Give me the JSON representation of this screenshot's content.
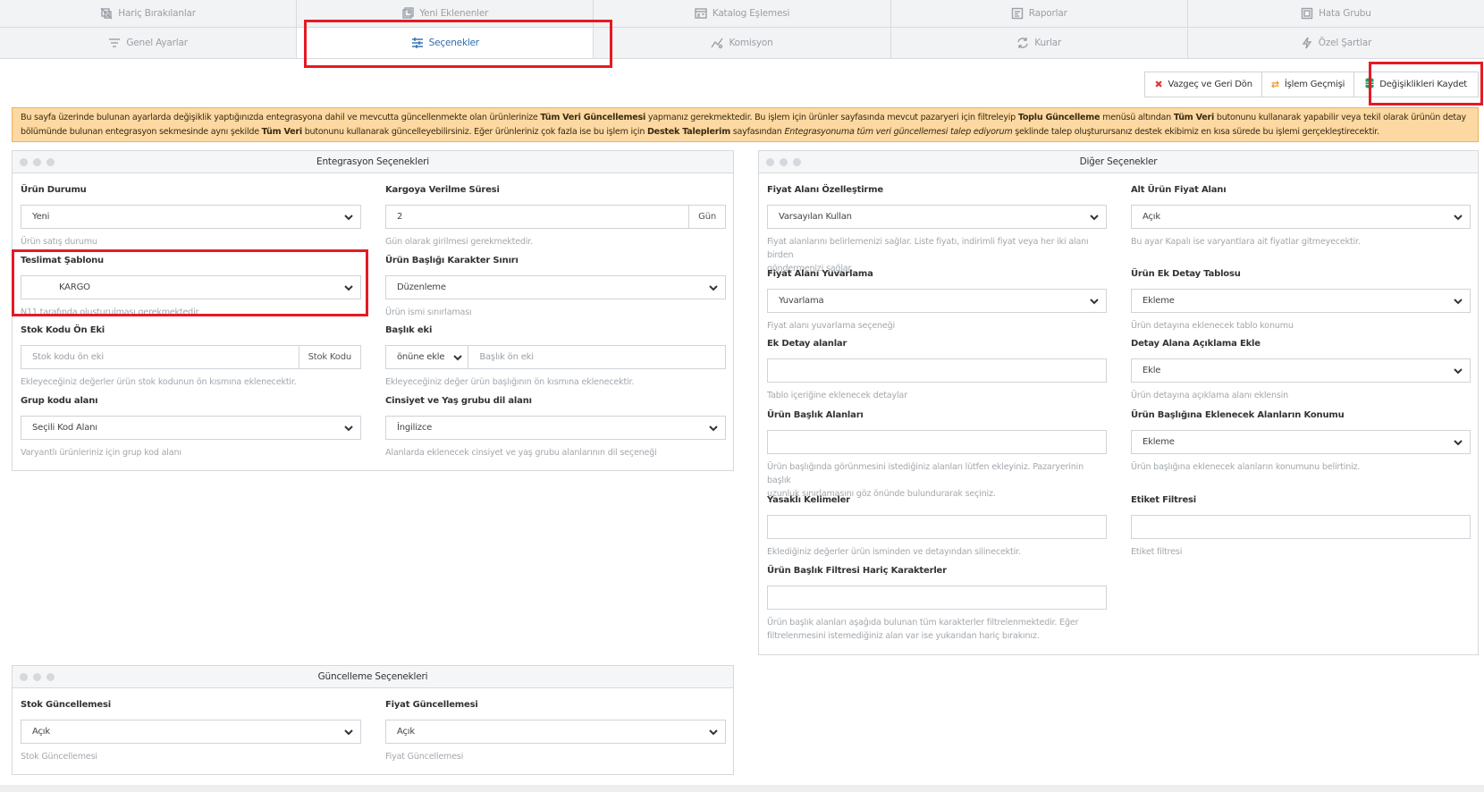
{
  "tabs_row1": [
    {
      "label": "Hariç Bırakılanlar",
      "icon": "exclude-icon"
    },
    {
      "label": "Yeni Eklenenler",
      "icon": "new-items-icon"
    },
    {
      "label": "Katalog Eşlemesi",
      "icon": "catalog-icon"
    },
    {
      "label": "Raporlar",
      "icon": "report-icon"
    },
    {
      "label": "Hata Grubu",
      "icon": "error-group-icon"
    }
  ],
  "tabs_row2": [
    {
      "label": "Genel Ayarlar",
      "icon": "filter-lines-icon"
    },
    {
      "label": "Seçenekler",
      "icon": "sliders-icon"
    },
    {
      "label": "Komisyon",
      "icon": "chart-icon"
    },
    {
      "label": "Kurlar",
      "icon": "exchange-icon"
    },
    {
      "label": "Özel Şartlar",
      "icon": "bolt-icon"
    }
  ],
  "actions": {
    "cancel": "Vazgeç ve Geri Dön",
    "history": "İşlem Geçmişi",
    "save": "Değişiklikleri Kaydet"
  },
  "notice": {
    "p1": "Bu sayfa üzerinde bulunan ayarlarda değişiklik yaptığınızda entegrasyona dahil ve mevcutta güncellenmekte olan ürünlerinize ",
    "b1": "Tüm Veri Güncellemesi",
    "p2": " yapmanız gerekmektedir. Bu işlem için ürünler sayfasında mevcut pazaryeri için filtreleyip ",
    "b2": "Toplu Güncelleme",
    "p3": " menüsü altından ",
    "b3": "Tüm Veri",
    "p4": " butonunu kullanarak yapabilir veya tekil olarak ürünün detay bölümünde bulunan entegrasyon sekmesinde aynı şekilde ",
    "b4": "Tüm Veri",
    "p5": " butonunu kullanarak güncelleyebilirsiniz. Eğer ürünleriniz çok fazla ise bu işlem için ",
    "b5": "Destek Taleplerim",
    "p6": " sayfasından ",
    "i1": "Entegrasyonuma tüm veri güncellemesi talep ediyorum",
    "p7": " şeklinde talep oluşturursanız destek ekibimiz en kısa sürede bu işlemi gerçekleştirecektir."
  },
  "integration": {
    "title": "Entegrasyon Seçenekleri",
    "urun_durumu": {
      "label": "Ürün Durumu",
      "value": "Yeni",
      "help": "Ürün satış durumu"
    },
    "kargo": {
      "label": "Kargoya Verilme Süresi",
      "value": "2",
      "addon": "Gün",
      "help": "Gün olarak girilmesi gerekmektedir."
    },
    "teslimat": {
      "label": "Teslimat Şablonu",
      "value": "KARGO",
      "help": "N11 tarafında oluşturulması gerekmektedir"
    },
    "baslik_sinir": {
      "label": "Ürün Başlığı Karakter Sınırı",
      "value": "Düzenleme",
      "help": "Ürün ismi sınırlaması"
    },
    "stok_on_ek": {
      "label": "Stok Kodu Ön Eki",
      "placeholder": "Stok kodu ön eki",
      "addon": "Stok Kodu",
      "help": "Ekleyeceğiniz değerler ürün stok kodunun ön kısmına eklenecektir."
    },
    "baslik_eki": {
      "label": "Başlık eki",
      "select": "önüne ekle",
      "placeholder": "Başlık ön eki",
      "help": "Ekleyeceğiniz değer ürün başlığının ön kısmına eklenecektir."
    },
    "grup_kodu": {
      "label": "Grup kodu alanı",
      "value": "Seçili Kod Alanı",
      "help": "Varyantlı ürünleriniz için grup kod alanı"
    },
    "cinsiyet": {
      "label": "Cinsiyet ve Yaş grubu dil alanı",
      "value": "İngilizce",
      "help": "Alanlarda eklenecek cinsiyet ve yaş grubu alanlarının dil seçeneği"
    }
  },
  "other": {
    "title": "Diğer Seçenekler",
    "fiyat_ozel": {
      "label": "Fiyat Alanı Özelleştirme",
      "value": "Varsayılan Kullan",
      "help1": "Fiyat alanlarını belirlemenizi sağlar. Liste fiyatı, indirimli fiyat veya her iki alanı birden",
      "help2": "göndermenizi sağlar."
    },
    "alt_urun": {
      "label": "Alt Ürün Fiyat Alanı",
      "value": "Açık",
      "help": "Bu ayar Kapalı ise varyantlara ait fiyatlar gitmeyecektir."
    },
    "yuvarlama": {
      "label": "Fiyat Alanı Yuvarlama",
      "value": "Yuvarlama",
      "help": "Fiyat alanı yuvarlama seçeneği"
    },
    "ek_detay_tablo": {
      "label": "Ürün Ek Detay Tablosu",
      "value": "Ekleme",
      "help": "Ürün detayına eklenecek tablo konumu"
    },
    "ek_detay": {
      "label": "Ek Detay alanlar",
      "help": "Tablo içeriğine eklenecek detaylar"
    },
    "aciklama": {
      "label": "Detay Alana Açıklama Ekle",
      "value": "Ekle",
      "help": "Ürün detayına açıklama alanı eklensin"
    },
    "baslik_alanlari": {
      "label": "Ürün Başlık Alanları",
      "help1": "Ürün başlığında görünmesini istediğiniz alanları lütfen ekleyiniz. Pazaryerinin başlık",
      "help2": "uzunluk sınırlamasını göz önünde bulundurarak seçiniz."
    },
    "baslik_konum": {
      "label": "Ürün Başlığına Eklenecek Alanların Konumu",
      "value": "Ekleme",
      "help": "Ürün başlığına eklenecek alanların konumunu belirtiniz."
    },
    "yasakli": {
      "label": "Yasaklı Kelimeler",
      "help": "Eklediğiniz değerler ürün isminden ve detayından silinecektir."
    },
    "etiket": {
      "label": "Etiket Filtresi",
      "help": "Etiket filtresi"
    },
    "haric_karakter": {
      "label": "Ürün Başlık Filtresi Hariç Karakterler",
      "help1": "Ürün başlık alanları aşağıda bulunan tüm karakterler filtrelenmektedir. Eğer",
      "help2": "filtrelenmesini istemediğiniz alan var ise yukarıdan hariç bırakınız."
    }
  },
  "update": {
    "title": "Güncelleme Seçenekleri",
    "stok": {
      "label": "Stok Güncellemesi",
      "value": "Açık",
      "help": "Stok Güncellemesi"
    },
    "fiyat": {
      "label": "Fiyat Güncellemesi",
      "value": "Açık",
      "help": "Fiyat Güncellemesi"
    }
  },
  "colors": {
    "accent": "#2c6cb0",
    "highlight": "#e41b23",
    "notice_bg": "#fcd9a2",
    "save_icon": "#1aa260",
    "cancel_icon": "#e23a3a",
    "history_icon": "#f0962a"
  }
}
